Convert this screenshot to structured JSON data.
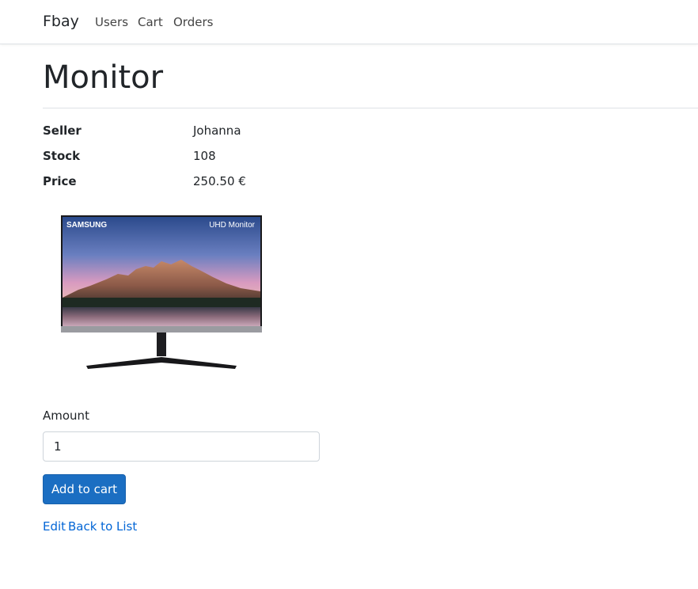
{
  "navbar": {
    "brand": "Fbay",
    "links": [
      "Users",
      "Cart",
      "Orders"
    ]
  },
  "page": {
    "title": "Monitor"
  },
  "details": [
    {
      "label": "Seller",
      "value": "Johanna"
    },
    {
      "label": "Stock",
      "value": "108"
    },
    {
      "label": "Price",
      "value": "250.50 €"
    }
  ],
  "image": {
    "brand_text": "SAMSUNG",
    "model_text": "UHD Monitor"
  },
  "form": {
    "amount_label": "Amount",
    "amount_value": "1",
    "submit_label": "Add to cart"
  },
  "links": {
    "edit": "Edit",
    "back": "Back to List"
  },
  "colors": {
    "primary": "#1b6ec2",
    "link": "#0366d6"
  }
}
